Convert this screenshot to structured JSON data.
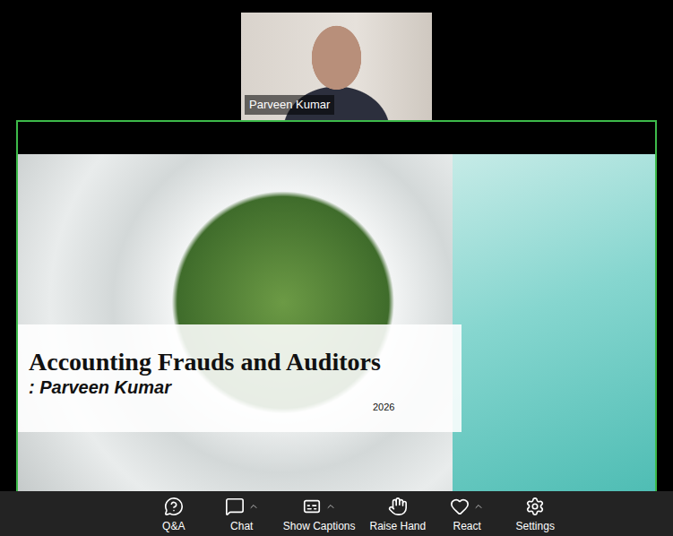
{
  "video": {
    "name": "Parveen Kumar"
  },
  "slide": {
    "title": "Accounting Frauds and Auditors",
    "subtitle": ": Parveen Kumar",
    "year": "2026"
  },
  "toolbar": [
    {
      "label": "Q&A",
      "caret": false
    },
    {
      "label": "Chat",
      "caret": true
    },
    {
      "label": "Show Captions",
      "caret": true
    },
    {
      "label": "Raise Hand",
      "caret": false
    },
    {
      "label": "React",
      "caret": true
    },
    {
      "label": "Settings",
      "caret": false
    }
  ]
}
